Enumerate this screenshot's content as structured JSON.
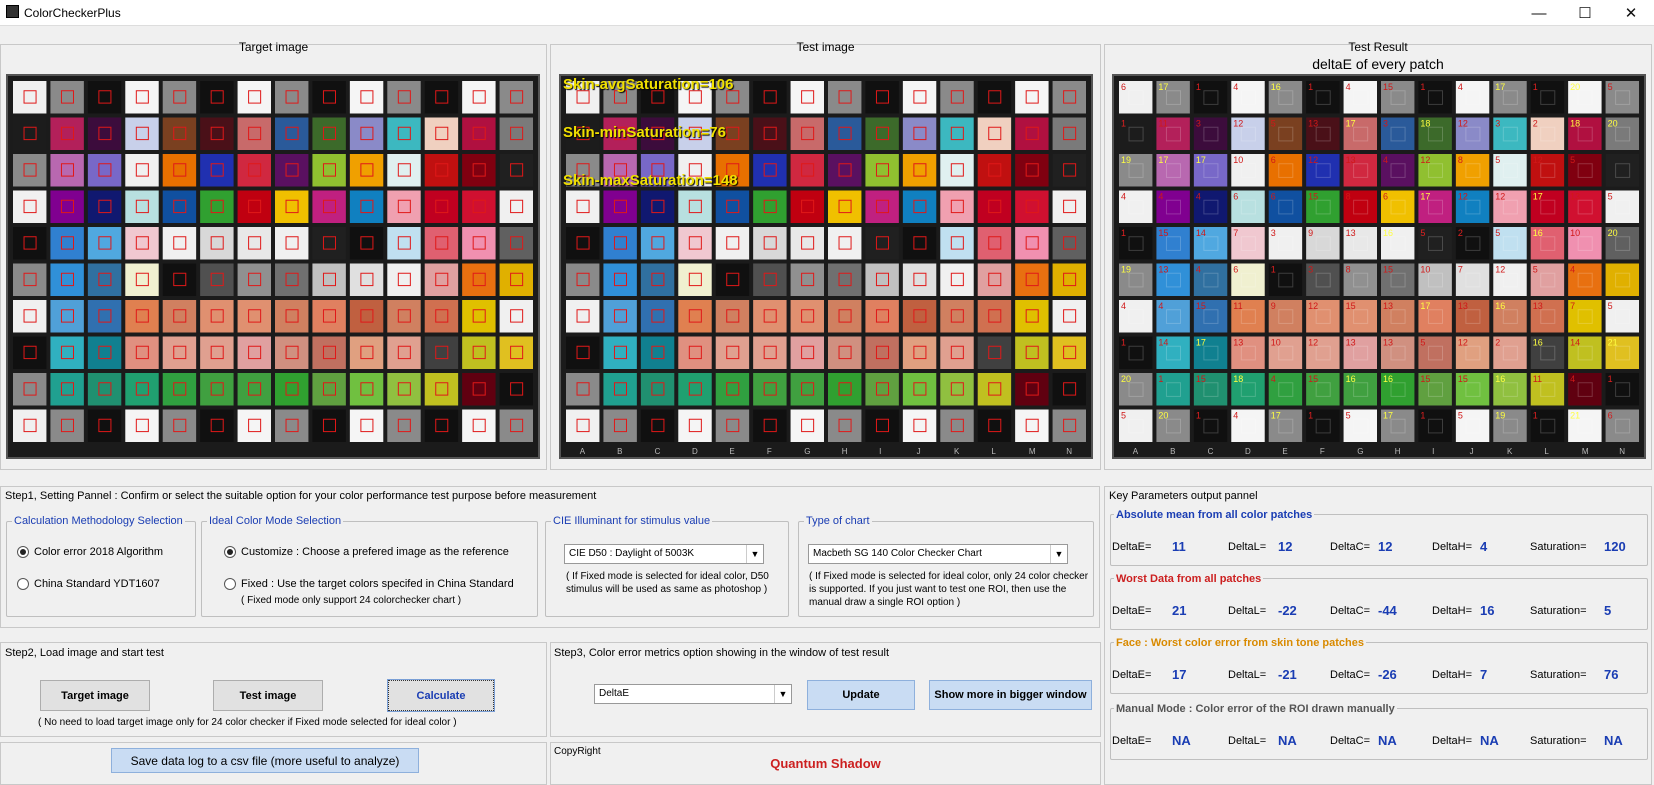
{
  "app": {
    "title": "ColorCheckerPlus",
    "minimize": "—",
    "maximize": "☐",
    "close": "✕"
  },
  "panels": {
    "target_title": "Target image",
    "test_title": "Test image",
    "result_title": "Test Result",
    "result_subtitle": "deltaE of every patch"
  },
  "overlays": {
    "skin_avg": "Skin-avgSaturation=106",
    "skin_min": "Skin-minSaturation=76",
    "skin_max": "Skin-maxSaturation=148"
  },
  "step1": {
    "title": "Step1, Setting Pannel : Confirm or select the suitable option for your color performance test purpose before measurement",
    "calc": {
      "label": "Calculation Methodology Selection",
      "opt1": "Color error 2018 Algorithm",
      "opt2": "China Standard YDT1607",
      "selected": 1
    },
    "ideal": {
      "label": "Ideal Color Mode Selection",
      "opt1": "Customize : Choose a prefered image as the reference",
      "opt2": "Fixed : Use the target colors specifed in China Standard",
      "opt2_note": "( Fixed mode only support 24 colorchecker chart )",
      "selected": 1
    },
    "cie": {
      "label": "CIE Illuminant for stimulus value",
      "value": "CIE D50 : Daylight of 5003K",
      "note": "( If Fixed mode is selected for ideal color, D50 stimulus will be used as same as photoshop )"
    },
    "chart": {
      "label": "Type of chart",
      "value": "Macbeth SG 140 Color Checker Chart",
      "note": "( If Fixed mode is selected for ideal color, only 24 color checker is supported. If you just want to test one ROI, then use the manual draw a single ROI option )"
    }
  },
  "step2": {
    "title": "Step2, Load image and start test",
    "target_btn": "Target image",
    "test_btn": "Test image",
    "calc_btn": "Calculate",
    "note": "( No need to load target image only for 24 color checker if Fixed mode selected for ideal color )",
    "save_btn": "Save data log to a csv file (more useful to analyze)"
  },
  "step3": {
    "title": "Step3, Color error metrics option showing in the window of test result",
    "metric": "DeltaE",
    "update_btn": "Update",
    "more_btn": "Show more in bigger window"
  },
  "copyright": {
    "label": "CopyRight",
    "value": "Quantum Shadow"
  },
  "keyparams": {
    "title": "Key Parameters output pannel",
    "labels": {
      "de": "DeltaE=",
      "dl": "DeltaL=",
      "dc": "DeltaC=",
      "dh": "DeltaH=",
      "sat": "Saturation="
    },
    "sections": [
      {
        "title": "Absolute mean from all color patches",
        "color": "#1a3db3",
        "de": "11",
        "dl": "12",
        "dc": "12",
        "dh": "4",
        "sat": "120"
      },
      {
        "title": "Worst Data from all patches",
        "color": "#cc1f1f",
        "de": "21",
        "dl": "-22",
        "dc": "-44",
        "dh": "16",
        "sat": "5"
      },
      {
        "title": "Face : Worst color error from skin tone patches",
        "color": "#d98a00",
        "de": "17",
        "dl": "-21",
        "dc": "-26",
        "dh": "7",
        "sat": "76"
      },
      {
        "title": "Manual Mode : Color error of the ROI drawn manually",
        "color": "#555555",
        "de": "NA",
        "dl": "NA",
        "dc": "NA",
        "dh": "NA",
        "sat": "NA"
      }
    ]
  },
  "grid": {
    "rows": [
      [
        "#f0f0f0",
        "#8a8a8a",
        "#101010",
        "#f5f5f5",
        "#8a8a8a",
        "#101010",
        "#f5f5f5",
        "#8a8a8a",
        "#101010",
        "#f5f5f5",
        "#8a8a8a",
        "#101010",
        "#f5f5f5",
        "#8a8a8a"
      ],
      [
        "#1c1c1c",
        "#b3205a",
        "#3c0c3c",
        "#c8d0ea",
        "#7a4020",
        "#4a1018",
        "#c86a6a",
        "#2a5a9a",
        "#3c6a2a",
        "#8a8ac8",
        "#3cb8c0",
        "#f0d0c0",
        "#b01040",
        "#7a7a7a"
      ],
      [
        "#8a8a8a",
        "#b868b0",
        "#7868c8",
        "#f0f0f0",
        "#e87000",
        "#2030b0",
        "#d02840",
        "#5a1060",
        "#90c030",
        "#f0a000",
        "#e0f0f0",
        "#c01010",
        "#800010",
        "#202020"
      ],
      [
        "#f0f0f0",
        "#800090",
        "#101870",
        "#b8e0e0",
        "#1050a0",
        "#30a030",
        "#c00010",
        "#f0c000",
        "#c02080",
        "#1080c0",
        "#f0a0b0",
        "#c00020",
        "#d01030",
        "#f0f0f0"
      ],
      [
        "#101010",
        "#3080d0",
        "#50a8e0",
        "#f0c8d0",
        "#f0f0f0",
        "#d8d8d8",
        "#e8e8e8",
        "#f0f0f0",
        "#202020",
        "#101010",
        "#c0e0f0",
        "#e06070",
        "#f090b0",
        "#606060"
      ],
      [
        "#8a8a8a",
        "#3090d8",
        "#3070a0",
        "#f0f0d0",
        "#101010",
        "#505050",
        "#909090",
        "#707070",
        "#c0c0c0",
        "#e0e0e0",
        "#f0f0f0",
        "#e0a0a0",
        "#e87010",
        "#e0b000"
      ],
      [
        "#f0f0f0",
        "#50a0d8",
        "#3070b0",
        "#e08050",
        "#d08060",
        "#e09070",
        "#e09070",
        "#d08060",
        "#e08060",
        "#c06040",
        "#d08060",
        "#d07050",
        "#e0c000",
        "#f0f0f0"
      ],
      [
        "#101010",
        "#30b0c0",
        "#108090",
        "#e09080",
        "#e0a090",
        "#e0a090",
        "#e0a0a0",
        "#d09080",
        "#c07060",
        "#e0a080",
        "#e0a090",
        "#404040",
        "#c0c020",
        "#e0c020"
      ],
      [
        "#8a8a8a",
        "#20a090",
        "#209070",
        "#20a070",
        "#30a040",
        "#40a040",
        "#40a040",
        "#30a030",
        "#60a040",
        "#70c040",
        "#90c040",
        "#c0c020",
        "#600010",
        "#101010"
      ],
      [
        "#f0f0f0",
        "#8a8a8a",
        "#101010",
        "#f5f5f5",
        "#8a8a8a",
        "#101010",
        "#f5f5f5",
        "#8a8a8a",
        "#101010",
        "#f5f5f5",
        "#8a8a8a",
        "#101010",
        "#f5f5f5",
        "#8a8a8a"
      ]
    ],
    "deltaE": [
      [
        "6",
        "17",
        "1",
        "4",
        "16",
        "1",
        "4",
        "15",
        "1",
        "4",
        "17",
        "1",
        "20",
        "5"
      ],
      [
        "1",
        "11",
        "3",
        "12",
        "5",
        "13",
        "17",
        "3",
        "18",
        "12",
        "3",
        "2",
        "18",
        "20"
      ],
      [
        "19",
        "17",
        "17",
        "10",
        "6",
        "12",
        "13",
        "4",
        "12",
        "8",
        "5",
        "12",
        "5",
        ""
      ],
      [
        "4",
        "4",
        "4",
        "6",
        "6",
        "15",
        "8",
        "6",
        "17",
        "12",
        "12",
        "17",
        "13",
        "5"
      ],
      [
        "1",
        "15",
        "14",
        "7",
        "3",
        "9",
        "13",
        "16",
        "5",
        "2",
        "5",
        "16",
        "10",
        "20"
      ],
      [
        "19",
        "13",
        "4",
        "6",
        "1",
        "3",
        "8",
        "15",
        "10",
        "7",
        "12",
        "5",
        "4",
        ""
      ],
      [
        "4",
        "4",
        "15",
        "11",
        "9",
        "12",
        "15",
        "13",
        "17",
        "13",
        "16",
        "13",
        "7",
        "5"
      ],
      [
        "1",
        "14",
        "17",
        "13",
        "10",
        "12",
        "13",
        "13",
        "5",
        "12",
        "2",
        "16",
        "14",
        "21"
      ],
      [
        "20",
        "1",
        "15",
        "18",
        "4",
        "15",
        "16",
        "16",
        "15",
        "15",
        "16",
        "11",
        "4",
        "1"
      ],
      [
        "5",
        "20",
        "1",
        "4",
        "17",
        "1",
        "5",
        "17",
        "1",
        "5",
        "19",
        "1",
        "21",
        "6"
      ]
    ],
    "col_letters": [
      "A",
      "B",
      "C",
      "D",
      "E",
      "F",
      "G",
      "H",
      "I",
      "J",
      "K",
      "L",
      "M",
      "N"
    ]
  }
}
